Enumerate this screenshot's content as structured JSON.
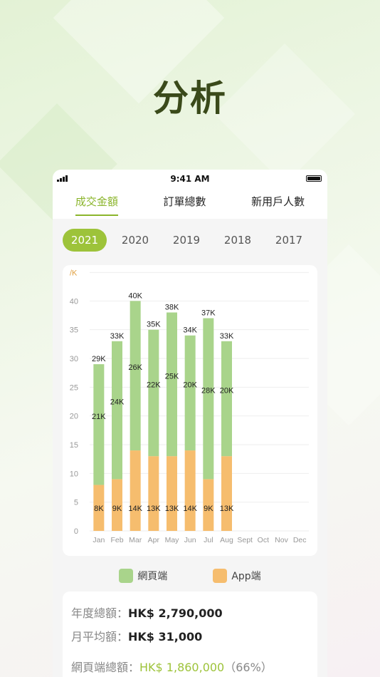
{
  "headline": "分析",
  "status_bar": {
    "time": "9:41 AM"
  },
  "tabs": [
    {
      "label": "成交金額",
      "active": true
    },
    {
      "label": "訂單總數",
      "active": false
    },
    {
      "label": "新用戶人數",
      "active": false
    }
  ],
  "years": [
    {
      "label": "2021",
      "active": true
    },
    {
      "label": "2020",
      "active": false
    },
    {
      "label": "2019",
      "active": false
    },
    {
      "label": "2018",
      "active": false
    },
    {
      "label": "2017",
      "active": false
    }
  ],
  "colors": {
    "accent": "#9dc33a",
    "web": "#a9d48b",
    "app": "#f6bd6e"
  },
  "chart_data": {
    "type": "bar",
    "stacked": true,
    "unit_label": "/K",
    "ylim": [
      0,
      45
    ],
    "yticks": [
      0,
      5,
      10,
      15,
      20,
      25,
      30,
      35,
      40
    ],
    "grid": true,
    "categories": [
      "Jan",
      "Feb",
      "Mar",
      "Apr",
      "May",
      "Jun",
      "Jul",
      "Aug",
      "Sept",
      "Oct",
      "Nov",
      "Dec"
    ],
    "series": [
      {
        "name": "App端",
        "values": [
          8,
          9,
          14,
          13,
          13,
          14,
          9,
          13,
          null,
          null,
          null,
          null
        ],
        "labels": [
          "8K",
          "9K",
          "14K",
          "13K",
          "13K",
          "14K",
          "9K",
          "13K"
        ]
      },
      {
        "name": "網頁端",
        "values": [
          21,
          24,
          26,
          22,
          25,
          20,
          28,
          20,
          null,
          null,
          null,
          null
        ],
        "labels": [
          "21K",
          "24K",
          "26K",
          "22K",
          "25K",
          "20K",
          "28K",
          "20K"
        ]
      }
    ],
    "totals": [
      "29K",
      "33K",
      "40K",
      "35K",
      "38K",
      "34K",
      "37K",
      "33K"
    ]
  },
  "legend": {
    "web_label": "網頁端",
    "app_label": "App端"
  },
  "summary": {
    "annual_label": "年度總額：",
    "annual_value": "HK$ 2,790,000",
    "monthly_label": "月平均額：",
    "monthly_value": "HK$ 31,000",
    "web_label": "網頁端總額：",
    "web_value": "HK$ 1,860,000",
    "web_pct": "（66%）"
  }
}
